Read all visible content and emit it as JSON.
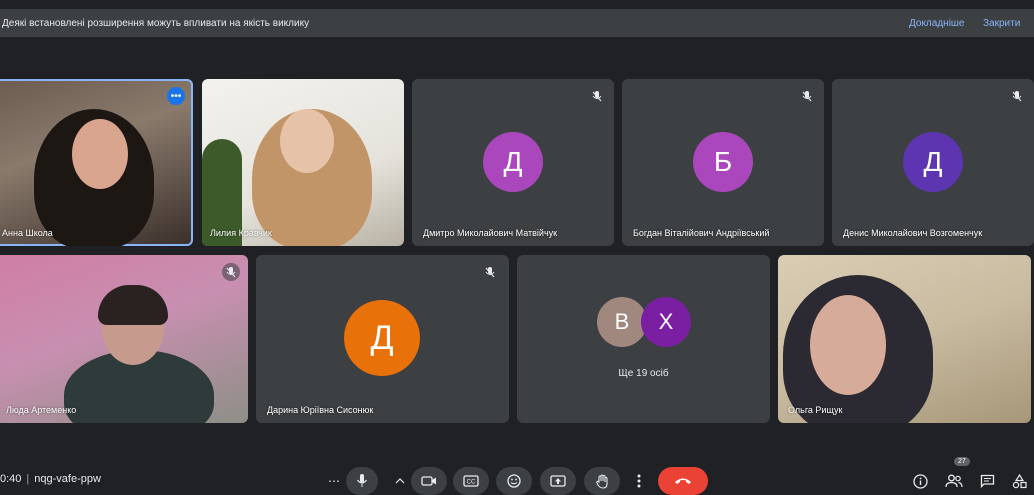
{
  "banner": {
    "message": "Деякі встановлені розширення можуть впливати на якість виклику",
    "details_label": "Докладніше",
    "close_label": "Закрити"
  },
  "participants": [
    {
      "name": "Анна Школа",
      "type": "video"
    },
    {
      "name": "Лилия Кравчик",
      "type": "video"
    },
    {
      "name": "Дмитро Миколайович Матвійчук",
      "type": "avatar",
      "initial": "Д",
      "color": "#ab47bc",
      "muted": true
    },
    {
      "name": "Богдан Віталійович Андріївський",
      "type": "avatar",
      "initial": "Б",
      "color": "#ab47bc",
      "muted": true
    },
    {
      "name": "Денис Миколайович Возгоменчук",
      "type": "avatar",
      "initial": "Д",
      "color": "#5e35b1",
      "muted": true
    },
    {
      "name": "Люда Артеменко",
      "type": "video",
      "muted": true
    },
    {
      "name": "Дарина Юріївна Сисонюк",
      "type": "avatar",
      "initial": "Д",
      "color": "#e8710a",
      "muted": true
    },
    {
      "name": "Ольга Рищук",
      "type": "video"
    }
  ],
  "overflow": {
    "initials": [
      "В",
      "Х"
    ],
    "colors": [
      "#a1887f",
      "#7b1fa2"
    ],
    "label": "Ще 19 осіб"
  },
  "meeting": {
    "time": "0:40",
    "code": "nqg-vafe-ppw"
  },
  "controls": {
    "more_label": "⋯",
    "people_count": "27"
  },
  "colors": {
    "accent": "#8ab4f8",
    "end_call": "#ea4335",
    "tile": "#3c4043",
    "background": "#202124"
  }
}
